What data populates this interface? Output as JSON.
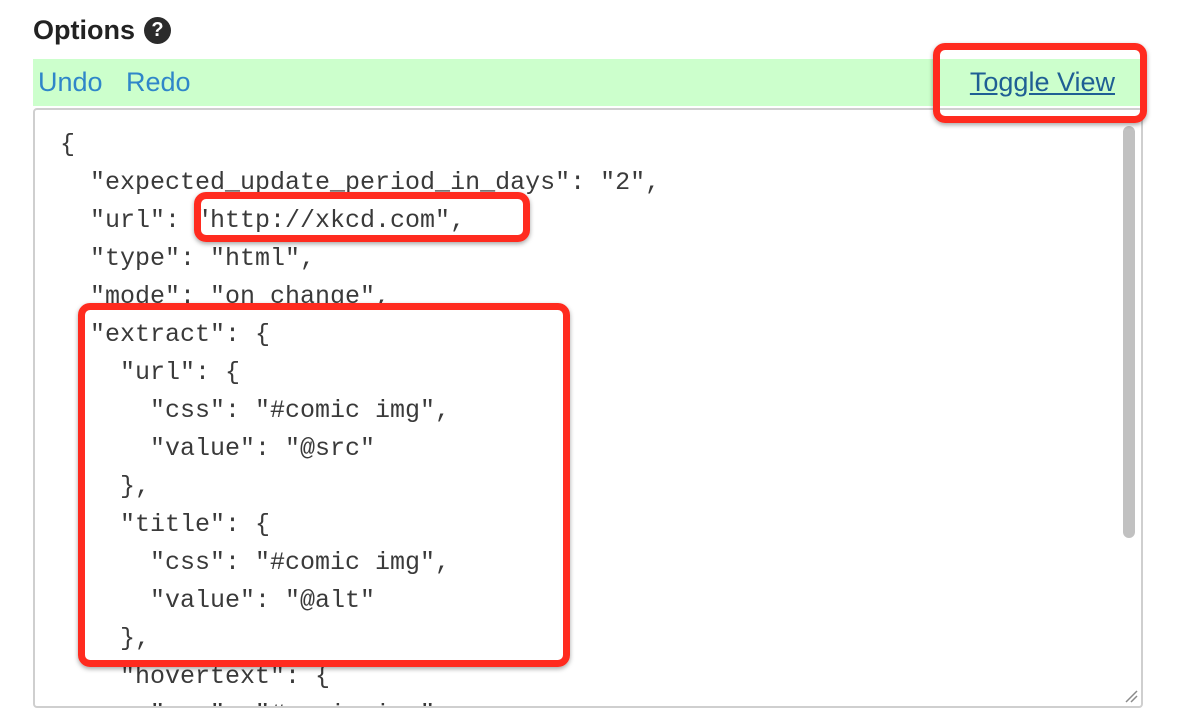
{
  "options": {
    "title": "Options",
    "help_glyph": "?"
  },
  "toolbar": {
    "undo": "Undo",
    "redo": "Redo",
    "toggle_view": "Toggle View",
    "background": "#ccffcc"
  },
  "editor": {
    "lines": [
      "{",
      "  \"expected_update_period_in_days\": \"2\",",
      "  \"url\": \"http://xkcd.com\",",
      "  \"type\": \"html\",",
      "  \"mode\": \"on_change\",",
      "  \"extract\": {",
      "    \"url\": {",
      "      \"css\": \"#comic img\",",
      "      \"value\": \"@src\"",
      "    },",
      "    \"title\": {",
      "      \"css\": \"#comic img\",",
      "      \"value\": \"@alt\"",
      "    },",
      "    \"hovertext\": {",
      "      \"css\": \"#comic img\","
    ]
  },
  "colors": {
    "highlight": "#ff2b1f",
    "link": "#2f86c9"
  },
  "icons": [
    "help-icon",
    "resize-grip-icon"
  ]
}
